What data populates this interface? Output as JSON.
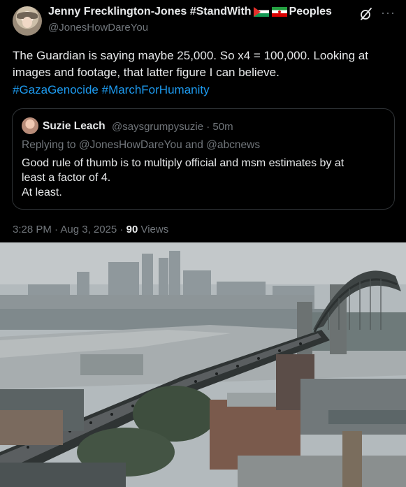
{
  "author": {
    "display_name_prefix": "Jenny Frecklington-Jones #StandWith",
    "display_name_suffix": "Peoples",
    "flags": [
      "palestine-flag-icon",
      "iran-flag-icon"
    ],
    "handle": "@JonesHowDareYou"
  },
  "tweet": {
    "text": "The Guardian is saying maybe 25,000. So x4 = 100,000. Looking at images and footage, that latter figure I can believe.",
    "hashtags": [
      "#GazaGenocide",
      "#MarchForHumanity"
    ]
  },
  "quoted_tweet": {
    "name": "Suzie Leach",
    "handle_time": "@saysgrumpysuzie · 50m",
    "replying_to": "Replying to @JonesHowDareYou and @abcnews",
    "text_lines": [
      "Good rule of thumb is to multiply official and msm estimates by at",
      "least a factor of 4.",
      "At least."
    ]
  },
  "meta": {
    "timestamp": "3:28 PM · Aug 3, 2025 · ",
    "views_count": "90",
    "views_label": " Views"
  },
  "icons": {
    "grok": "grok-icon",
    "more": "more-icon",
    "more_glyph": "···"
  },
  "colors": {
    "background": "#000000",
    "text": "#e7e9ea",
    "muted": "#71767b",
    "link": "#1d9bf0",
    "border": "#2f3336"
  }
}
